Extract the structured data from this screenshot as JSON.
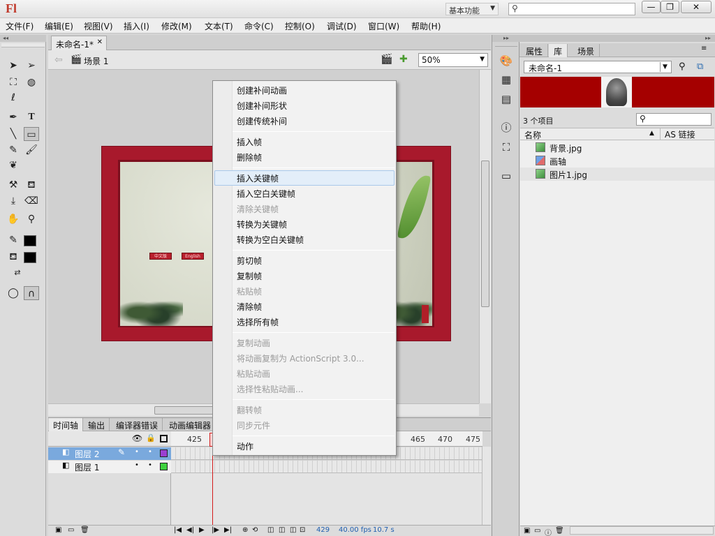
{
  "titlebar": {
    "app": "Fl",
    "workspace": "基本功能",
    "minimize": "—",
    "restore": "❐",
    "close": "✕"
  },
  "menubar": {
    "items": [
      "文件(F)",
      "编辑(E)",
      "视图(V)",
      "插入(I)",
      "修改(M)",
      "文本(T)",
      "命令(C)",
      "控制(O)",
      "调试(D)",
      "窗口(W)",
      "帮助(H)"
    ]
  },
  "document": {
    "tab": "未命名-1*",
    "scene": "场景 1",
    "zoom": "50%"
  },
  "stage": {
    "btn1": "中文版",
    "btn2": "English"
  },
  "context_menu": {
    "items": [
      {
        "label": "创建补间动画",
        "enabled": true
      },
      {
        "label": "创建补间形状",
        "enabled": true
      },
      {
        "label": "创建传统补间",
        "enabled": true
      },
      {
        "label": "插入帧",
        "enabled": true
      },
      {
        "label": "删除帧",
        "enabled": true
      },
      {
        "label": "插入关键帧",
        "enabled": true
      },
      {
        "label": "插入空白关键帧",
        "enabled": true
      },
      {
        "label": "清除关键帧",
        "enabled": false
      },
      {
        "label": "转换为关键帧",
        "enabled": true
      },
      {
        "label": "转换为空白关键帧",
        "enabled": true
      },
      {
        "label": "剪切帧",
        "enabled": true
      },
      {
        "label": "复制帧",
        "enabled": true
      },
      {
        "label": "粘贴帧",
        "enabled": false
      },
      {
        "label": "清除帧",
        "enabled": true
      },
      {
        "label": "选择所有帧",
        "enabled": true
      },
      {
        "label": "复制动画",
        "enabled": false
      },
      {
        "label": "将动画复制为 ActionScript 3.0...",
        "enabled": false
      },
      {
        "label": "粘贴动画",
        "enabled": false
      },
      {
        "label": "选择性粘贴动画...",
        "enabled": false
      },
      {
        "label": "翻转帧",
        "enabled": false
      },
      {
        "label": "同步元件",
        "enabled": false
      },
      {
        "label": "动作",
        "enabled": true
      }
    ],
    "highlighted": "插入关键帧"
  },
  "timeline": {
    "tabs": [
      "时间轴",
      "输出",
      "编译器错误",
      "动画编辑器"
    ],
    "ruler": [
      "425",
      "465",
      "470",
      "475"
    ],
    "layers": [
      {
        "name": "图层 2",
        "color": "#9b3fd1"
      },
      {
        "name": "图层 1",
        "color": "#3fd13f"
      }
    ],
    "frame": "429",
    "fps": "40.00 fps",
    "time": "10.7 s"
  },
  "library": {
    "tabs": [
      "属性",
      "库",
      "场景"
    ],
    "file": "未命名-1",
    "count": "3 个项目",
    "col_name": "名称",
    "col_link": "AS 链接",
    "items": [
      {
        "label": "背景.jpg",
        "type": "bitmap"
      },
      {
        "label": "画轴",
        "type": "symbol"
      },
      {
        "label": "图片1.jpg",
        "type": "bitmap"
      }
    ]
  }
}
